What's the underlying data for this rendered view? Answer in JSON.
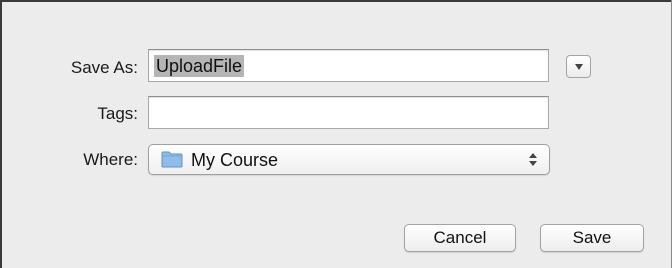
{
  "dialog": {
    "save_as_label": "Save As:",
    "save_as_value": "UploadFile",
    "tags_label": "Tags:",
    "tags_value": "",
    "where_label": "Where:",
    "where_value": "My Course"
  },
  "buttons": {
    "cancel": "Cancel",
    "save": "Save"
  },
  "icons": {
    "expand": "disclosure-triangle-icon",
    "location": "folder-icon",
    "popup_arrows": "up-down-arrows-icon"
  },
  "colors": {
    "background": "#ececec",
    "folder_blue": "#8fbde8",
    "selection": "#b5b5b5"
  }
}
